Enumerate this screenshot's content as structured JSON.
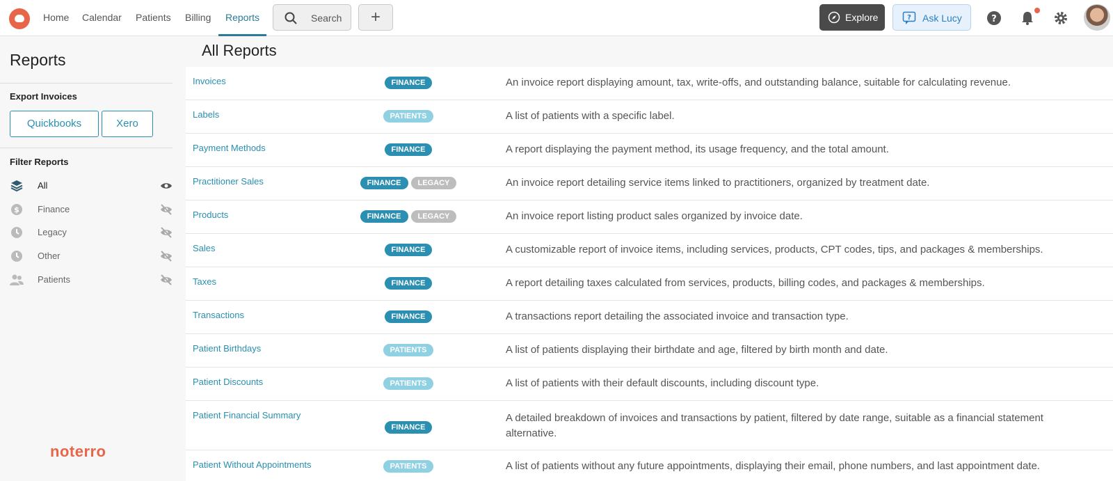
{
  "nav": {
    "items": [
      "Home",
      "Calendar",
      "Patients",
      "Billing",
      "Reports"
    ],
    "search_label": "Search",
    "plus_label": "+",
    "explore_label": "Explore",
    "ask_label": "Ask Lucy"
  },
  "sidebar": {
    "title": "Reports",
    "export_heading": "Export Invoices",
    "export_buttons": [
      "Quickbooks",
      "Xero"
    ],
    "filter_heading": "Filter Reports",
    "filters": [
      "All",
      "Finance",
      "Legacy",
      "Other",
      "Patients"
    ],
    "brand": "noterro"
  },
  "main": {
    "title": "All Reports",
    "reports": [
      {
        "name": "Invoices",
        "tags": [
          "FINANCE"
        ],
        "desc": "An invoice report displaying amount, tax, write-offs, and outstanding balance, suitable for calculating revenue."
      },
      {
        "name": "Labels",
        "tags": [
          "PATIENTS"
        ],
        "desc": "A list of patients with a specific label."
      },
      {
        "name": "Payment Methods",
        "tags": [
          "FINANCE"
        ],
        "desc": "A report displaying the payment method, its usage frequency, and the total amount."
      },
      {
        "name": "Practitioner Sales",
        "tags": [
          "FINANCE",
          "LEGACY"
        ],
        "desc": "An invoice report detailing service items linked to practitioners, organized by treatment date."
      },
      {
        "name": "Products",
        "tags": [
          "FINANCE",
          "LEGACY"
        ],
        "desc": "An invoice report listing product sales organized by invoice date."
      },
      {
        "name": "Sales",
        "tags": [
          "FINANCE"
        ],
        "desc": "A customizable report of invoice items, including services, products, CPT codes, tips, and packages & memberships."
      },
      {
        "name": "Taxes",
        "tags": [
          "FINANCE"
        ],
        "desc": "A report detailing taxes calculated from services, products, billing codes, and packages & memberships."
      },
      {
        "name": "Transactions",
        "tags": [
          "FINANCE"
        ],
        "desc": "A transactions report detailing the associated invoice and transaction type."
      },
      {
        "name": "Patient Birthdays",
        "tags": [
          "PATIENTS"
        ],
        "desc": "A list of patients displaying their birthdate and age, filtered by birth month and date."
      },
      {
        "name": "Patient Discounts",
        "tags": [
          "PATIENTS"
        ],
        "desc": "A list of patients with their default discounts, including discount type."
      },
      {
        "name": "Patient Financial Summary",
        "tags": [
          "FINANCE"
        ],
        "desc": "A detailed breakdown of invoices and transactions by patient, filtered by date range, suitable as a financial statement alternative."
      },
      {
        "name": "Patient Without Appointments",
        "tags": [
          "PATIENTS"
        ],
        "desc": "A list of patients without any future appointments, displaying their email, phone numbers, and last appointment date."
      }
    ]
  }
}
